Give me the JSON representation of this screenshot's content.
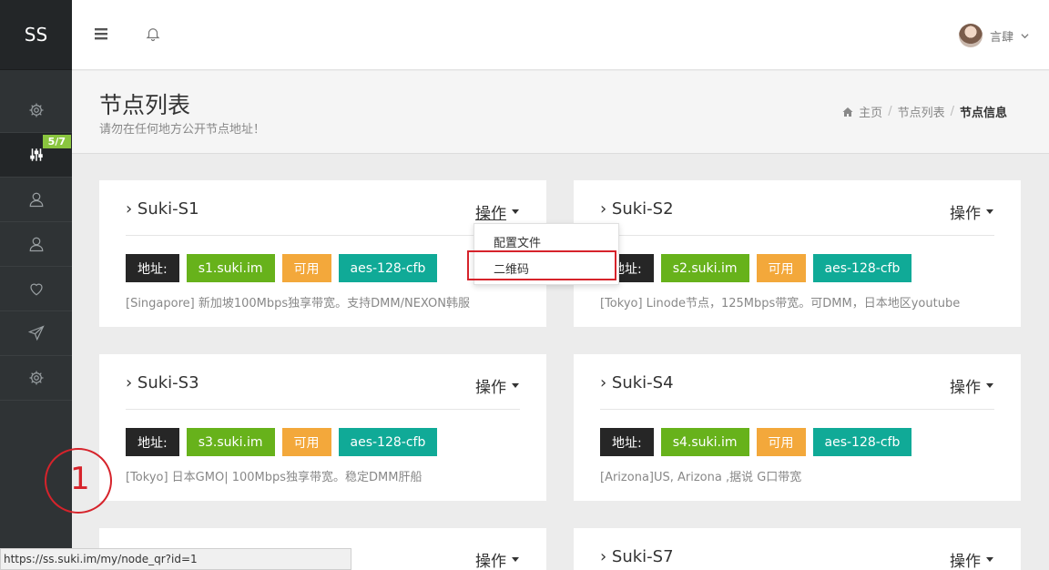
{
  "sidebar": {
    "logo": "SS",
    "badge": "5/7",
    "items": [
      {
        "icon": "gear-icon"
      },
      {
        "icon": "sliders-icon"
      },
      {
        "icon": "user-icon"
      },
      {
        "icon": "user-icon"
      },
      {
        "icon": "heart-icon"
      },
      {
        "icon": "send-icon"
      },
      {
        "icon": "gear-icon"
      }
    ]
  },
  "topbar": {
    "user_name": "言肆"
  },
  "page": {
    "title": "节点列表",
    "subtitle": "请勿在任何地方公开节点地址！",
    "breadcrumb": [
      "主页",
      "节点列表",
      "节点信息"
    ]
  },
  "dropdown": {
    "items": [
      "配置文件",
      "二维码"
    ]
  },
  "nodes": [
    {
      "name": "Suki-S1",
      "action": "操作",
      "addr_label": "地址:",
      "host": "s1.suki.im",
      "status": "可用",
      "method": "aes-128-cfb",
      "desc": "[Singapore] 新加坡100Mbps独享带宽。支持DMM/NEXON韩服"
    },
    {
      "name": "Suki-S2",
      "action": "操作",
      "addr_label": "地址:",
      "host": "s2.suki.im",
      "status": "可用",
      "method": "aes-128-cfb",
      "desc": "[Tokyo] Linode节点，125Mbps带宽。可DMM，日本地区youtube"
    },
    {
      "name": "Suki-S3",
      "action": "操作",
      "addr_label": "地址:",
      "host": "s3.suki.im",
      "status": "可用",
      "method": "aes-128-cfb",
      "desc": "[Tokyo] 日本GMO| 100Mbps独享带宽。稳定DMM肝船"
    },
    {
      "name": "Suki-S4",
      "action": "操作",
      "addr_label": "地址:",
      "host": "s4.suki.im",
      "status": "可用",
      "method": "aes-128-cfb",
      "desc": "[Arizona]US, Arizona ,据说 G口带宽"
    },
    {
      "name": "",
      "action": "操作"
    },
    {
      "name": "Suki-S7",
      "action": "操作"
    }
  ],
  "annotation": "1",
  "status_url": "https://ss.suki.im/my/node_qr?id=1"
}
